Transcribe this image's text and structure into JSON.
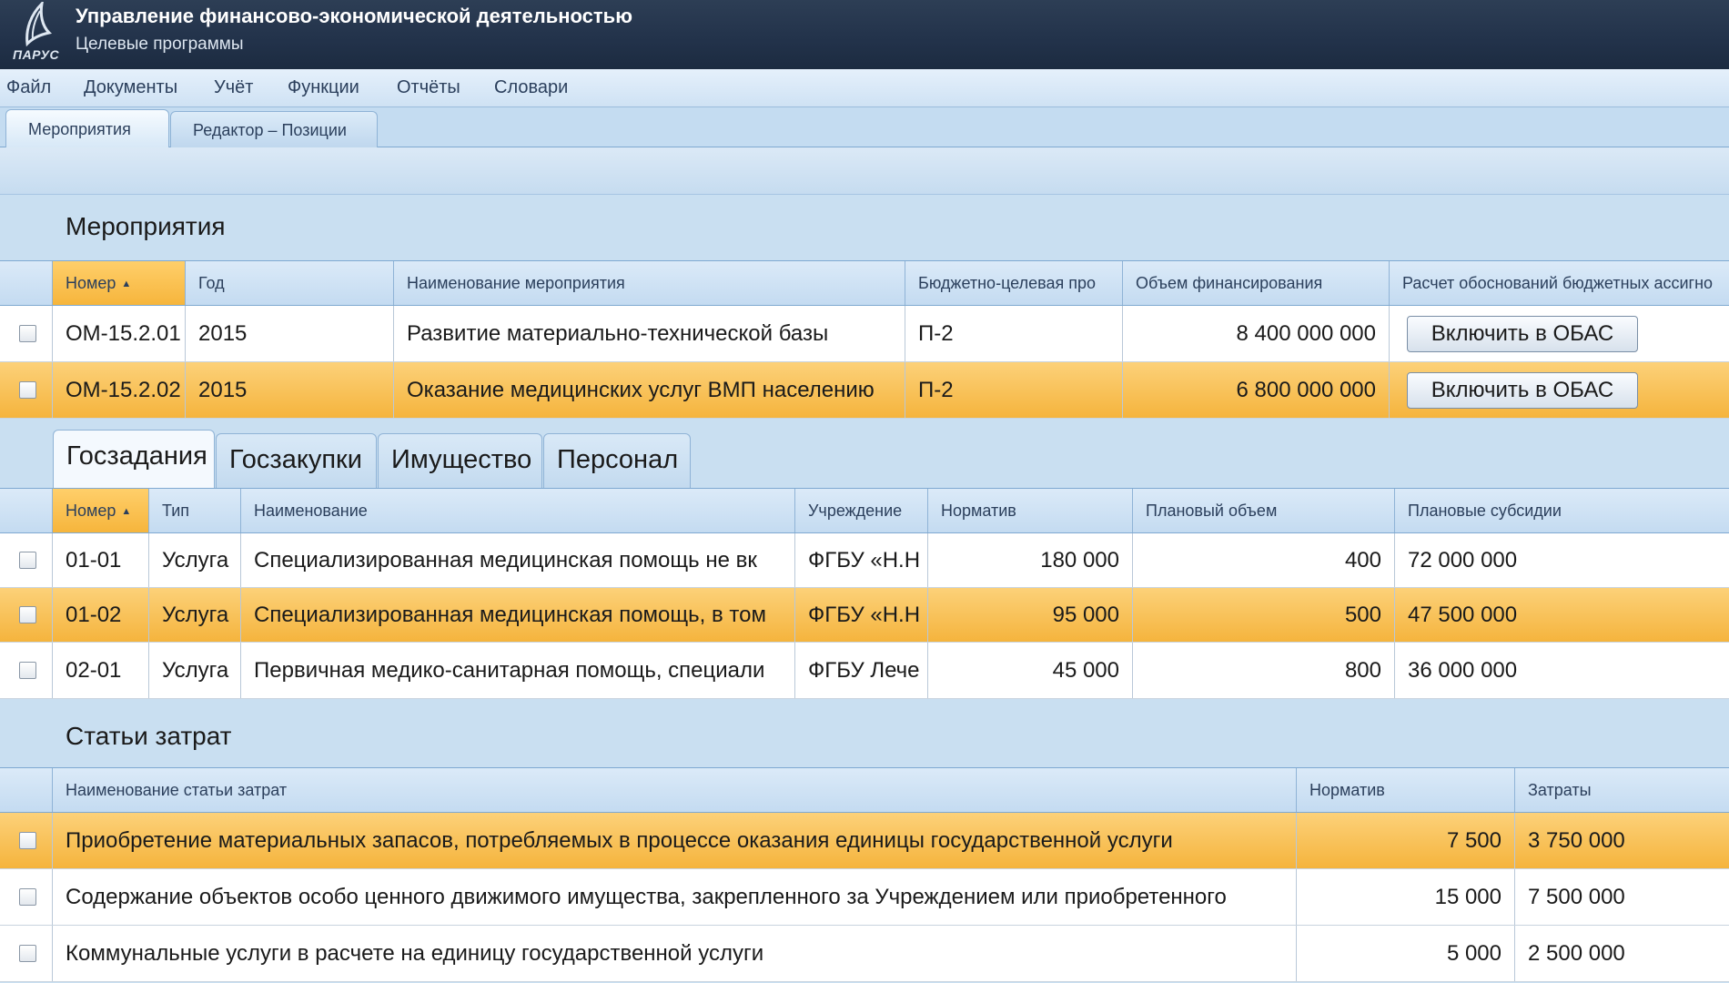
{
  "app": {
    "logo_text": "ПАРУС",
    "title": "Управление финансово-экономической деятельностью",
    "subtitle": "Целевые программы"
  },
  "menu": [
    "Файл",
    "Документы",
    "Учёт",
    "Функции",
    "Отчёты",
    "Словари"
  ],
  "top_tabs": [
    {
      "label": "Мероприятия",
      "active": true
    },
    {
      "label": "Редактор – Позиции",
      "active": false
    }
  ],
  "events": {
    "title": "Мероприятия",
    "columns": [
      "Номер",
      "Год",
      "Наименование мероприятия",
      "Бюджетно-целевая про",
      "Объем финансирования",
      "Расчет обоснований бюджетных ассигно"
    ],
    "rows": [
      {
        "number": "ОМ-15.2.01",
        "year": "2015",
        "name": "Развитие материально-технической базы",
        "program": "П-2",
        "funding": "8 400 000 000",
        "action": "Включить в ОБАС",
        "selected": false
      },
      {
        "number": "ОМ-15.2.02",
        "year": "2015",
        "name": "Оказание медицинских услуг ВМП населению",
        "program": "П-2",
        "funding": "6 800 000 000",
        "action": "Включить в ОБАС",
        "selected": true
      }
    ]
  },
  "sub_tabs": [
    {
      "label": "Госзадания",
      "active": true
    },
    {
      "label": "Госзакупки",
      "active": false
    },
    {
      "label": "Имущество",
      "active": false
    },
    {
      "label": "Персонал",
      "active": false
    }
  ],
  "assignments": {
    "columns": [
      "Номер",
      "Тип",
      "Наименование",
      "Учреждение",
      "Норматив",
      "Плановый объем",
      "Плановые субсидии"
    ],
    "rows": [
      {
        "number": "01-01",
        "type": "Услуга",
        "name": "Специализированная медицинская помощь не вк",
        "institution": "ФГБУ «Н.Н",
        "norm": "180 000",
        "volume": "400",
        "subsidy": "72 000 000",
        "selected": false
      },
      {
        "number": "01-02",
        "type": "Услуга",
        "name": "Специализированная медицинская помощь, в том",
        "institution": "ФГБУ «Н.Н",
        "norm": "95 000",
        "volume": "500",
        "subsidy": "47 500 000",
        "selected": true
      },
      {
        "number": "02-01",
        "type": "Услуга",
        "name": "Первичная медико-санитарная помощь, специали",
        "institution": "ФГБУ Лече",
        "norm": "45 000",
        "volume": "800",
        "subsidy": "36 000 000",
        "selected": false
      }
    ]
  },
  "costs": {
    "title": "Статьи затрат",
    "columns": [
      "Наименование статьи затрат",
      "Норматив",
      "Затраты"
    ],
    "rows": [
      {
        "name": "Приобретение материальных запасов, потребляемых в процессе оказания единицы государственной услуги",
        "norm": "7 500",
        "cost": "3 750 000",
        "selected": true
      },
      {
        "name": "Содержание объектов особо ценного движимого имущества, закрепленного за Учреждением или приобретенного",
        "norm": "15 000",
        "cost": "7 500 000",
        "selected": false
      },
      {
        "name": "Коммунальные услуги в расчете на единицу государственной услуги",
        "norm": "5 000",
        "cost": "2 500 000",
        "selected": false
      }
    ]
  }
}
